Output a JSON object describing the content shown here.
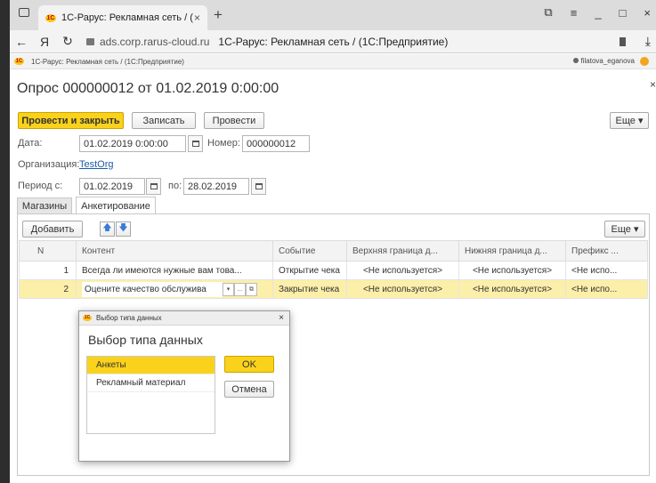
{
  "browser": {
    "tab_title": "1С-Рарус: Рекламная сеть / (",
    "logo_text": "1С",
    "new_tab": "+",
    "tab_close": "×",
    "back": "←",
    "yandex": "Я",
    "reload": "↻",
    "domain": "ads.corp.rarus-cloud.ru",
    "page_title": "1С-Рарус: Рекламная сеть / (1С:Предприятие)",
    "download": "⤓",
    "win_buttons": [
      "⧉",
      "≡",
      "_",
      "□",
      "×"
    ]
  },
  "app": {
    "breadcrumb": "1С-Рарус: Рекламная сеть /  (1С:Предприятие)",
    "user": "filatova_eganova"
  },
  "form": {
    "title": "Опрос 000000012 от 01.02.2019 0:00:00",
    "close": "×",
    "toolbar": {
      "post_close": "Провести и закрыть",
      "save": "Записать",
      "post": "Провести",
      "more": "Еще ▾"
    },
    "date_label": "Дата:",
    "date_value": "01.02.2019  0:00:00",
    "number_label": "Номер:",
    "number_value": "000000012",
    "org_label": "Организация:",
    "org_value": "TestOrg",
    "period_label": "Период  с:",
    "period_from": "01.02.2019",
    "period_to_label": "по:",
    "period_to": "28.02.2019"
  },
  "tabs": [
    {
      "label": "Магазины"
    },
    {
      "label": "Анкетирование"
    }
  ],
  "table_toolbar": {
    "add": "Добавить",
    "up": "🡅",
    "down": "🡇",
    "more": "Еще ▾"
  },
  "grid": {
    "columns": [
      "N",
      "Контент",
      "Событие",
      "Верхняя граница д...",
      "Нижняя граница д...",
      "Префикс ..."
    ],
    "rows": [
      {
        "n": "1",
        "content": "Всегда ли имеются нужные вам това...",
        "event": "Открытие чека",
        "upper": "<Не используется>",
        "lower": "<Не используется>",
        "prefix": "<Не испо..."
      },
      {
        "n": "2",
        "content": "Оцените качество обслужива",
        "event": "Закрытие чека",
        "upper": "<Не используется>",
        "lower": "<Не используется>",
        "prefix": "<Не испо..."
      }
    ],
    "cell_buttons": [
      "▾",
      "...",
      "⧉"
    ]
  },
  "dialog": {
    "header": "Выбор типа данных",
    "close": "×",
    "title": "Выбор типа данных",
    "items": [
      "Анкеты",
      "Рекламный материал"
    ],
    "ok": "OK",
    "cancel": "Отмена"
  },
  "colors": {
    "accent": "#fbd21b",
    "selected_row": "#fcefa9",
    "link": "#1f5aa8"
  }
}
